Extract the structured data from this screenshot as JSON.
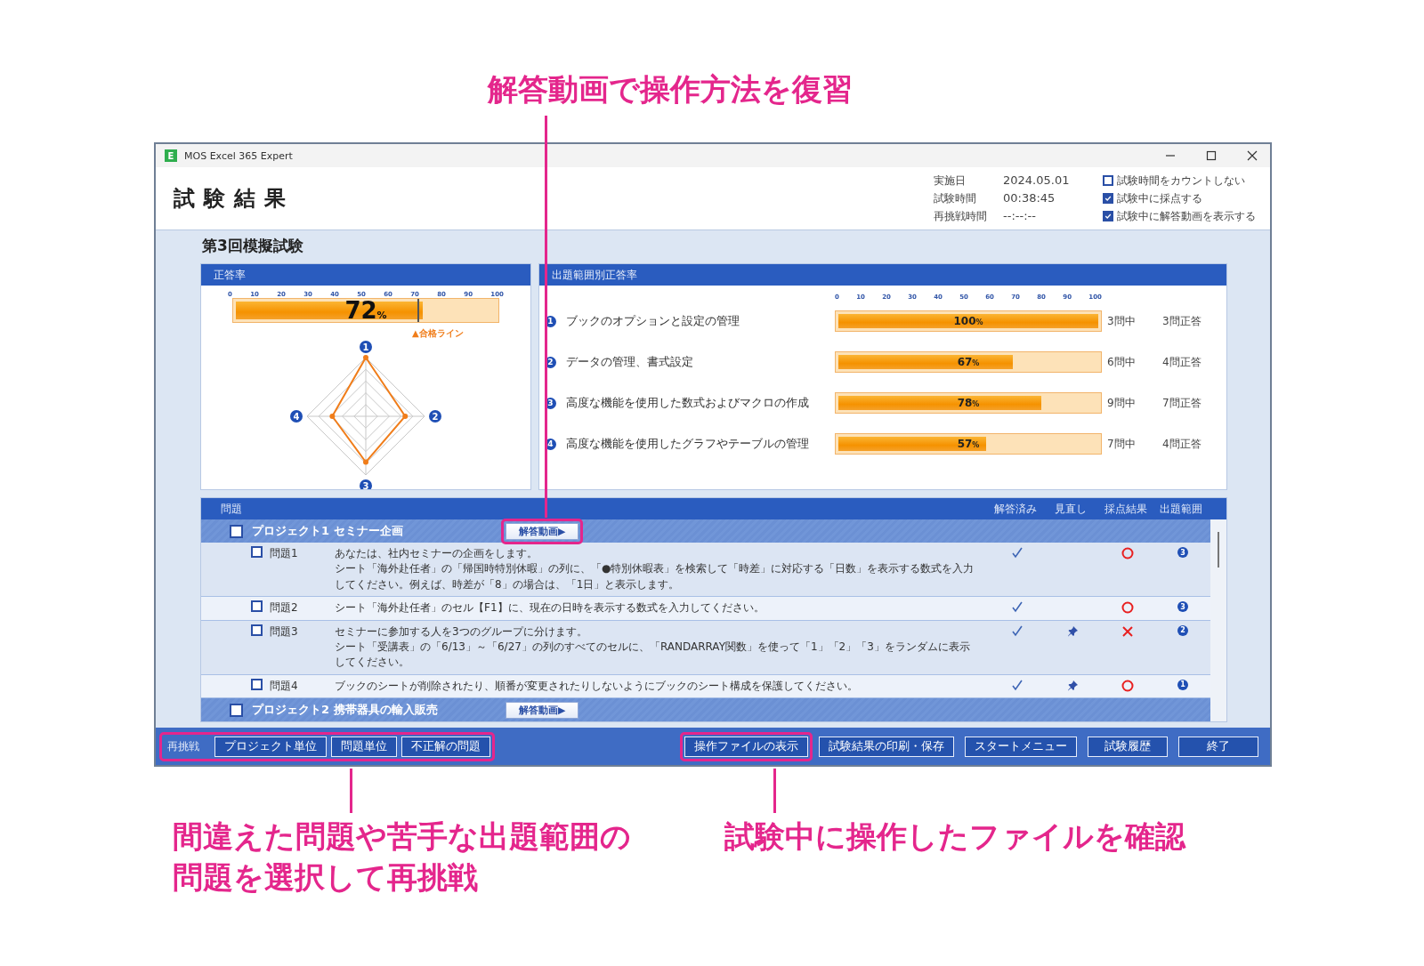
{
  "callouts": [
    {
      "lines": [
        "解答動画で操作方法を復習"
      ]
    },
    {
      "lines": [
        "間違えた問題や苦手な出題範囲の",
        "問題を選択して再挑戦"
      ]
    },
    {
      "lines": [
        "試験中に操作したファイルを確認"
      ]
    }
  ],
  "window": {
    "icon_letter": "E",
    "title": "MOS Excel 365 Expert"
  },
  "header": {
    "title": "試験結果",
    "info": [
      {
        "label": "実施日",
        "value": "2024.05.01"
      },
      {
        "label": "試験時間",
        "value": "00:38:45"
      },
      {
        "label": "再挑戦時間",
        "value": "--:--:--"
      }
    ],
    "options": [
      {
        "label": "試験時間をカウントしない",
        "checked": false
      },
      {
        "label": "試験中に採点する",
        "checked": true
      },
      {
        "label": "試験中に解答動画を表示する",
        "checked": true
      }
    ]
  },
  "exam_name": "第3回模擬試験",
  "score_panel": {
    "title": "正答率",
    "ticks": [
      "0",
      "10",
      "20",
      "30",
      "40",
      "50",
      "60",
      "70",
      "80",
      "90",
      "100"
    ],
    "value": "72",
    "unit": "%",
    "level": 0.72,
    "pass_line": {
      "label": "▲合格ライン",
      "level": 0.7
    },
    "radar_labels": [
      "1",
      "2",
      "3",
      "4"
    ]
  },
  "domain_panel": {
    "title": "出題範囲別正答率",
    "ticks": [
      "0",
      "10",
      "20",
      "30",
      "40",
      "50",
      "60",
      "70",
      "80",
      "90",
      "100"
    ],
    "domains": [
      {
        "number": "1",
        "name": "ブックのオプションと設定の管理",
        "level": 1.0,
        "percent": "100",
        "unit": "%",
        "total": "3問中",
        "correct": "3問正答"
      },
      {
        "number": "2",
        "name": "データの管理、書式設定",
        "level": 0.67,
        "percent": "67",
        "unit": "%",
        "total": "6問中",
        "correct": "4問正答"
      },
      {
        "number": "3",
        "name": "高度な機能を使用した数式およびマクロの作成",
        "level": 0.78,
        "percent": "78",
        "unit": "%",
        "total": "9問中",
        "correct": "7問正答"
      },
      {
        "number": "4",
        "name": "高度な機能を使用したグラフやテーブルの管理",
        "level": 0.57,
        "percent": "57",
        "unit": "%",
        "total": "7問中",
        "correct": "4問正答"
      }
    ]
  },
  "questions_table": {
    "columns": [
      "問題",
      "解答済み",
      "見直し",
      "採点結果",
      "出題範囲"
    ],
    "projects": [
      {
        "title": "プロジェクト1 セミナー企画",
        "checked": false,
        "video_button": "解答動画▶",
        "highlighted": true,
        "questions": [
          {
            "label": "問題1",
            "checked": false,
            "text": [
              "あなたは、社内セミナーの企画をします。",
              "シート「海外赴任者」の「帰国時特別休暇」の列に、「●特別休暇表」を検索して「時差」に対応する「日数」を表示する数式を入力してください。例えば、時差が「8」の場合は、「1日」と表示します。"
            ],
            "answered": true,
            "review": false,
            "correct": true,
            "range": "3"
          },
          {
            "label": "問題2",
            "checked": false,
            "text": [
              "シート「海外赴任者」のセル【F1】に、現在の日時を表示する数式を入力してください。"
            ],
            "answered": true,
            "review": false,
            "correct": true,
            "range": "3"
          },
          {
            "label": "問題3",
            "checked": false,
            "text": [
              "セミナーに参加する人を3つのグループに分けます。",
              "シート「受講表」の「6/13」～「6/27」の列のすべてのセルに、「RANDARRAY関数」を使って「1」「2」「3」をランダムに表示してください。"
            ],
            "answered": true,
            "review": true,
            "correct": false,
            "range": "2"
          },
          {
            "label": "問題4",
            "checked": false,
            "text": [
              "ブックのシートが削除されたり、順番が変更されたりしないようにブックのシート構成を保護してください。"
            ],
            "answered": true,
            "review": true,
            "correct": true,
            "range": "1"
          }
        ]
      },
      {
        "title": "プロジェクト2 携帯器具の輸入販売",
        "checked": false,
        "video_button": "解答動画▶",
        "highlighted": false
      }
    ]
  },
  "footer": {
    "retry": {
      "label": "再挑戦",
      "highlighted": true,
      "buttons": [
        "プロジェクト単位",
        "問題単位",
        "不正解の問題"
      ]
    },
    "actions": [
      {
        "label": "操作ファイルの表示",
        "highlighted": true
      },
      {
        "label": "試験結果の印刷・保存",
        "highlighted": false
      },
      {
        "label": "スタートメニュー",
        "highlighted": false
      },
      {
        "label": "試験履歴",
        "highlighted": false
      },
      {
        "label": "終了",
        "highlighted": false
      }
    ]
  }
}
